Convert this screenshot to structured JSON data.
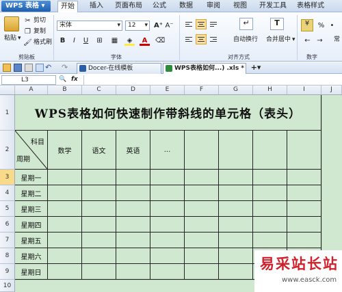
{
  "app": {
    "name": "WPS 表格"
  },
  "menu": {
    "tabs": [
      "开始",
      "插入",
      "页面布局",
      "公式",
      "数据",
      "审阅",
      "视图",
      "开发工具",
      "表格样式"
    ],
    "active": "开始"
  },
  "ribbon": {
    "paste": "粘贴",
    "cut": "剪切",
    "copy": "复制",
    "format_painter": "格式刷",
    "clipboard_group": "剪贴板",
    "font_name": "宋体",
    "font_size": "12",
    "bold": "B",
    "italic": "I",
    "underline": "U",
    "grow_font": "A⁺",
    "shrink_font": "A⁻",
    "font_group": "字体",
    "wrap_text": "自动换行",
    "merge_center": "合并居中",
    "align_group": "对齐方式",
    "percent": "%",
    "number_group": "数字",
    "more": "常"
  },
  "doc_tabs": [
    {
      "label": "Docer-在线模板",
      "active": false
    },
    {
      "label": "WPS表格如何...) .xls *",
      "active": true
    }
  ],
  "formula": {
    "cell_ref": "L3",
    "fx": "fx",
    "value": ""
  },
  "sheet": {
    "columns": [
      "A",
      "B",
      "C",
      "D",
      "E",
      "F",
      "G",
      "H",
      "I",
      "J"
    ],
    "rows": [
      "1",
      "2",
      "3",
      "4",
      "5",
      "6",
      "7",
      "8",
      "9",
      "10"
    ],
    "selected_row": "3",
    "title": "WPS表格如何快速制作带斜线的单元格（表头）",
    "header_top": "科目",
    "header_bottom": "周期",
    "subjects": [
      "数学",
      "语文",
      "英语",
      "..."
    ],
    "weekdays": [
      "星期一",
      "星期二",
      "星期三",
      "星期四",
      "星期五",
      "星期六",
      "星期日"
    ]
  },
  "watermark": {
    "text": "易采站长站",
    "url": "www.easck.com"
  },
  "colors": {
    "sheet_fill": "#cfe8cf",
    "active_tab": "#ffffff",
    "selection": "#f9d98a",
    "watermark": "#d0202a"
  }
}
